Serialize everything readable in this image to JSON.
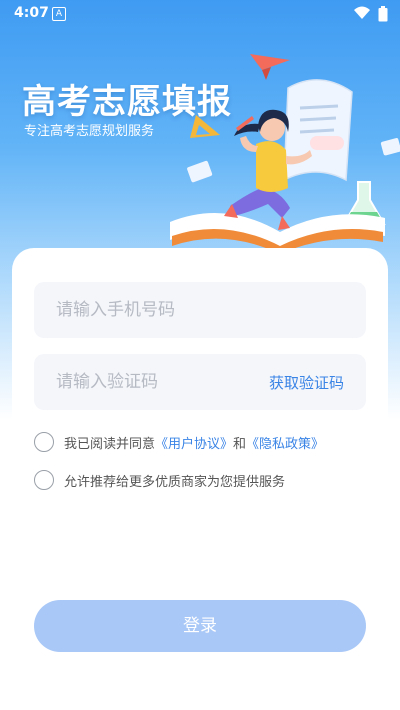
{
  "status_bar": {
    "time": "4:07",
    "notification_letter": "A"
  },
  "brand": {
    "title": "高考志愿填报",
    "subtitle": "专注高考志愿规划服务"
  },
  "form": {
    "phone_placeholder": "请输入手机号码",
    "code_placeholder": "请输入验证码",
    "get_code_label": "获取验证码"
  },
  "agreements": {
    "agree_prefix": "我已阅读并同意",
    "user_agreement": "《用户协议》",
    "and": "和",
    "privacy_policy": "《隐私政策》",
    "recommend_text": "允许推荐给更多优质商家为您提供服务"
  },
  "login_label": "登录",
  "colors": {
    "accent": "#3a84e6",
    "button": "#a9c8f7",
    "hero_top": "#3f9bf2"
  }
}
